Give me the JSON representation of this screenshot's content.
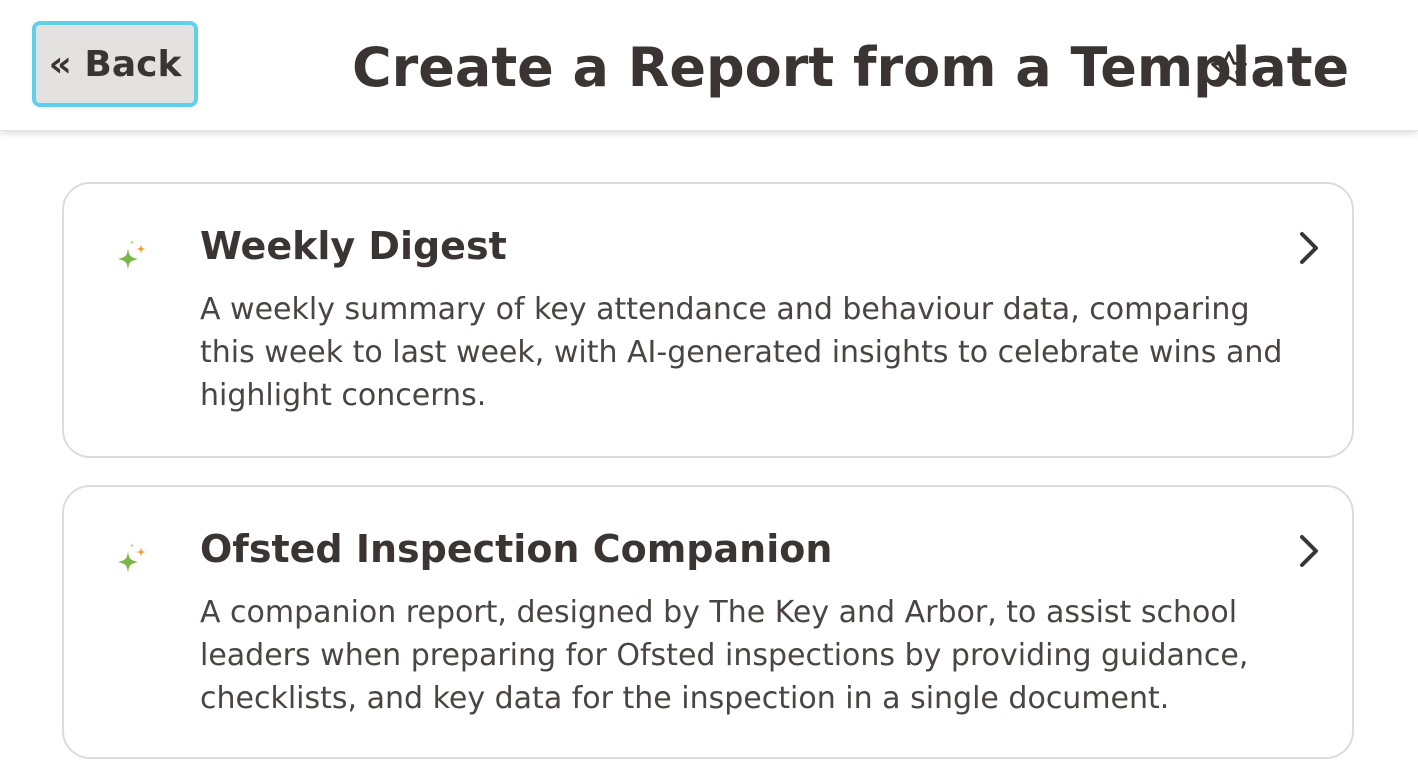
{
  "header": {
    "back_label": "« Back",
    "title": "Create a Report from a Template",
    "star_icon": "star-outline-icon"
  },
  "templates": [
    {
      "icon": "sparkle-icon",
      "title": "Weekly Digest",
      "description": "A weekly summary of key attendance and behaviour data, comparing this week to last week, with AI-generated insights to celebrate wins and highlight concerns."
    },
    {
      "icon": "sparkle-icon",
      "title": "Ofsted Inspection Companion",
      "description": "A companion report, designed by The Key and Arbor, to assist school leaders when preparing for Ofsted inspections by providing guidance, checklists, and key data for the inspection in a single document."
    }
  ],
  "colors": {
    "focus_outline": "#5fd0ea",
    "sparkle_green": "#7ab648",
    "sparkle_orange": "#f0a030",
    "text": "#3a3533"
  }
}
